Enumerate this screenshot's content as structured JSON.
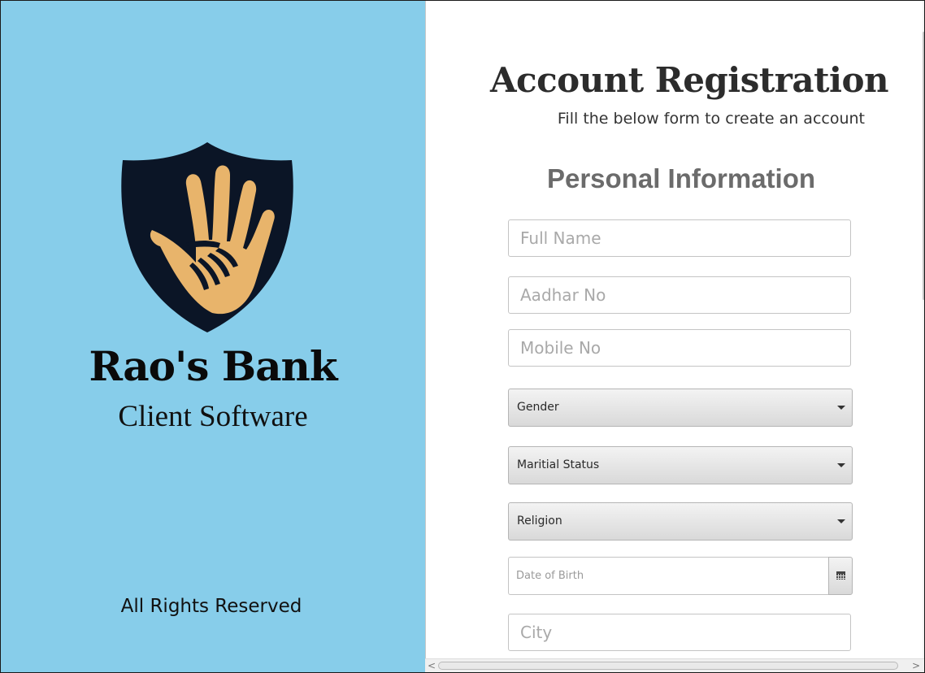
{
  "brand": {
    "logo_icon": "hands-shield-icon",
    "name": "Rao's Bank",
    "subtitle": "Client Software",
    "footer": "All Rights Reserved",
    "panel_color": "#87cdea",
    "shield_color": "#0b1526",
    "hand_color": "#e8b46b"
  },
  "form": {
    "title": "Account Registration",
    "subtitle": "Fill the below form to create an account",
    "section_title": "Personal Information",
    "fields": {
      "full_name": {
        "placeholder": "Full Name",
        "value": ""
      },
      "aadhar": {
        "placeholder": "Aadhar No",
        "value": ""
      },
      "mobile": {
        "placeholder": "Mobile No",
        "value": ""
      },
      "gender": {
        "label": "Gender"
      },
      "marital_status": {
        "label": "Maritial Status"
      },
      "religion": {
        "label": "Religion"
      },
      "dob": {
        "placeholder": "Date of Birth",
        "value": "",
        "icon": "calendar-icon"
      },
      "city": {
        "placeholder": "City",
        "value": ""
      }
    }
  },
  "scrollbar": {
    "left_arrow": "<",
    "right_arrow": ">",
    "down_arrow": "v"
  }
}
